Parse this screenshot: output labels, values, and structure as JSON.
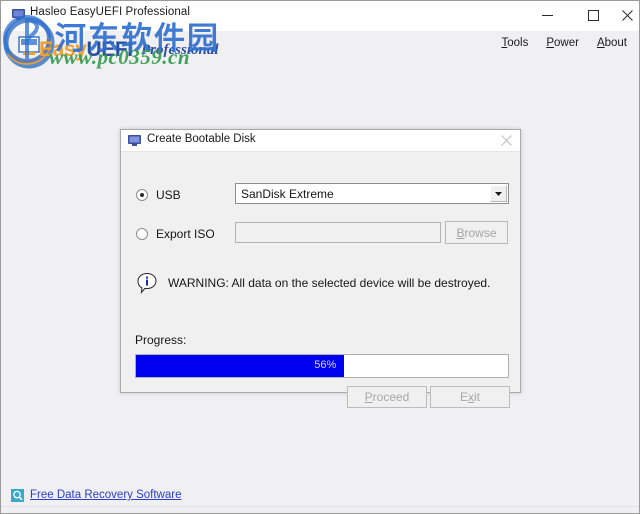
{
  "window": {
    "title": "Hasleo EasyUEFI Professional",
    "icon": "app-icon",
    "controls": {
      "minimize": "minimize-icon",
      "maximize": "maximize-icon",
      "close": "close-icon"
    }
  },
  "menu": {
    "items": [
      {
        "label": "Tools",
        "mnemonic": "T"
      },
      {
        "label": "Power",
        "mnemonic": "P"
      },
      {
        "label": "About",
        "mnemonic": "A"
      }
    ]
  },
  "branding": {
    "logo_name_easy": "Easy",
    "logo_name_uefi": "UEFI",
    "logo_edition": "Professional",
    "watermark_cn": "河东软件园",
    "watermark_url": "www.pc0359.cn",
    "colors": {
      "logo_orange": "#f0a030",
      "logo_blue": "#2b4fa0",
      "watermark_blue": "#2f6fd0",
      "watermark_green": "#2f9a4a"
    }
  },
  "dialog": {
    "title": "Create Bootable Disk",
    "icon": "monitor-icon",
    "close_label": "close-icon",
    "options": {
      "usb": {
        "label": "USB",
        "selected": true
      },
      "export_iso": {
        "label": "Export ISO",
        "selected": false
      }
    },
    "device_combo": {
      "value": "SanDisk Extreme",
      "arrow": "chevron-down-icon"
    },
    "iso_path": {
      "value": "",
      "placeholder": ""
    },
    "browse_button": {
      "label": "Browse",
      "mnemonic": "B",
      "enabled": false
    },
    "warning": {
      "icon": "info-icon",
      "text": "WARNING: All data on the selected device will be destroyed."
    },
    "progress": {
      "label": "Progress:",
      "percent": 56,
      "percent_text": "56%",
      "fill_color": "#0000f0"
    },
    "buttons": [
      {
        "label": "Proceed",
        "mnemonic": "P",
        "enabled": false
      },
      {
        "label": "Exit",
        "mnemonic": "x",
        "enabled": false
      }
    ]
  },
  "footer": {
    "link_icon": "search-icon",
    "link_label": "Free Data Recovery Software"
  }
}
